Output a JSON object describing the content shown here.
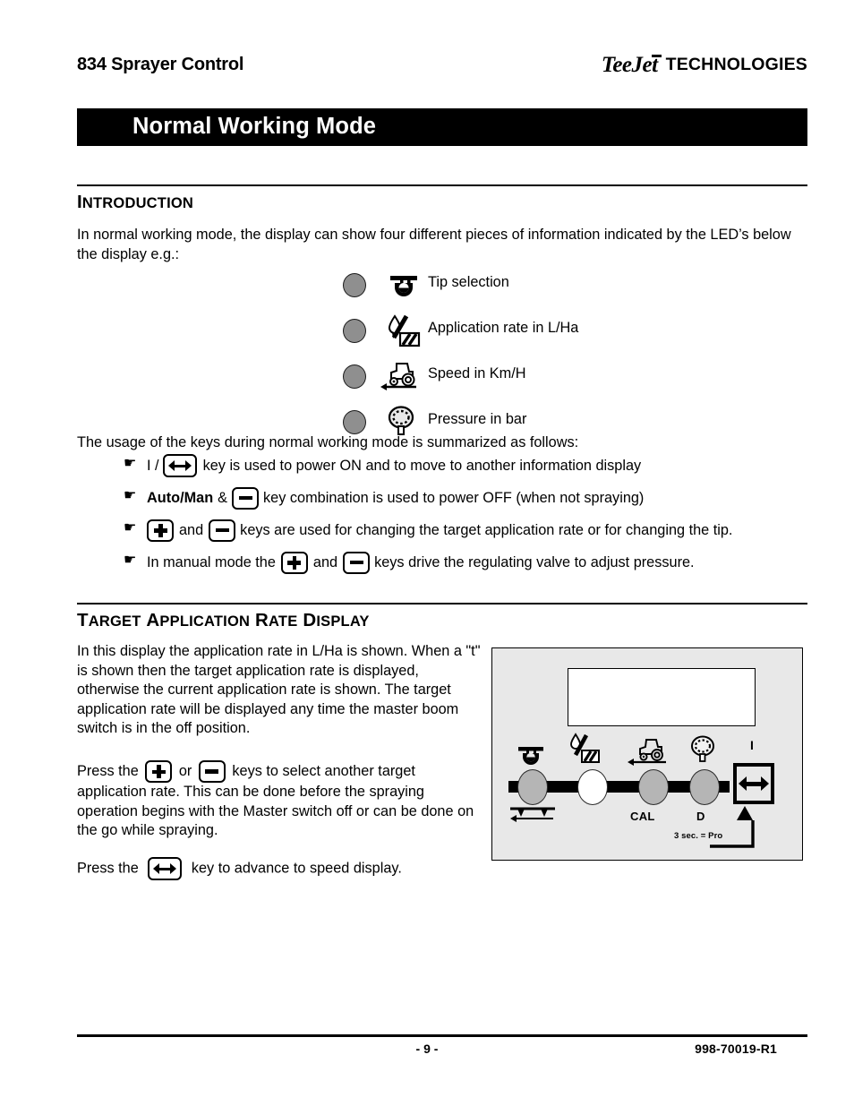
{
  "header": {
    "doc_title": "834 Sprayer Control",
    "brand_logo": "TeeJet",
    "brand_word": "TECHNOLOGIES"
  },
  "title_bar": {
    "title": "Normal Working Mode"
  },
  "introduction": {
    "heading_first": "I",
    "heading_rest": "NTRODUCTION",
    "paragraph": "In normal working mode, the display can show four different pieces of information indicated by the LED’s below the display e.g.:",
    "led_items": [
      {
        "icon": "nozzle-tip-icon",
        "label": "Tip selection"
      },
      {
        "icon": "droplet-field-icon",
        "label": "Application rate in L/Ha"
      },
      {
        "icon": "tractor-speed-icon",
        "label": "Speed in Km/H"
      },
      {
        "icon": "pressure-gauge-icon",
        "label": "Pressure in bar"
      }
    ],
    "keys_intro": "The usage of the keys during normal working mode is summarized as follows:",
    "bullets": [
      {
        "marker": "☛",
        "pre": "I /",
        "key": "left-right-arrow-key",
        "post": "key is used to power ON and to move to another information display"
      },
      {
        "marker": "☛",
        "pre_bold": "Auto/Man",
        "pre": "&",
        "key": "minus-key",
        "post": "key combination is used to power OFF (when not spraying)"
      },
      {
        "marker": "☛",
        "key_a": "plus-key",
        "mid": "and",
        "key_b": "minus-key",
        "post": "keys are used for changing the target application rate or for changing the tip."
      },
      {
        "marker": "☛",
        "pre": "In manual mode the",
        "key_a": "plus-key",
        "mid": "and",
        "key_b": "minus-key",
        "post": "keys drive the regulating valve to adjust pressure."
      }
    ]
  },
  "target_section": {
    "heading_parts": [
      {
        "cap": "T",
        "rest": "ARGET"
      },
      {
        "cap": "A",
        "rest": "PPLICATION"
      },
      {
        "cap": "R",
        "rest": "ATE"
      },
      {
        "cap": "D",
        "rest": "ISPLAY"
      }
    ],
    "paragraph_1": "In this display the application rate in L/Ha is shown.  When a \"t\" is shown then the target application rate is displayed, otherwise the current application rate is shown.  The target application rate will be displayed any time the master boom switch is in the off position.",
    "paragraph_2_pre": "Press the",
    "paragraph_2_mid": "or",
    "paragraph_2_post": "keys to select another target application rate.  This can be done before the spraying operation begins with the Master switch off or can be done on the go while spraying.",
    "paragraph_3_pre": "Press the",
    "paragraph_3_post": "key to advance to speed display.",
    "panel": {
      "leds": [
        {
          "name": "tip-led",
          "state": "on"
        },
        {
          "name": "application-rate-led",
          "state": "off"
        },
        {
          "name": "speed-led",
          "state": "on"
        },
        {
          "name": "pressure-led",
          "state": "on"
        }
      ],
      "label_cal": "CAL",
      "label_d": "D",
      "label_i": "I",
      "note": "3 sec. = Pro"
    }
  },
  "footer": {
    "page_number": "- 9 -",
    "doc_code": "998-70019-R1"
  }
}
